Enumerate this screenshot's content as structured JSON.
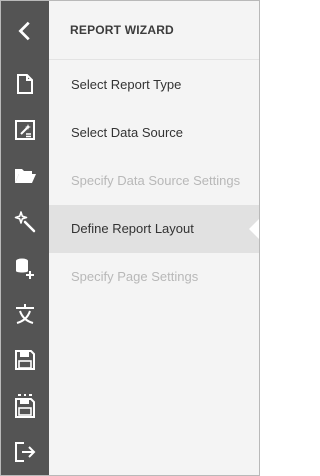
{
  "panel": {
    "title": "REPORT WIZARD"
  },
  "steps": [
    {
      "label": "Select Report Type",
      "state": "enabled"
    },
    {
      "label": "Select Data Source",
      "state": "enabled"
    },
    {
      "label": "Specify Data Source Settings",
      "state": "disabled"
    },
    {
      "label": "Define Report Layout",
      "state": "active"
    },
    {
      "label": "Specify Page Settings",
      "state": "disabled"
    }
  ],
  "toolbar": {
    "icons": [
      "back-chevron-icon",
      "new-report-icon",
      "new-report-wizard-icon",
      "open-folder-icon",
      "magic-wand-icon",
      "add-data-source-icon",
      "localization-icon",
      "save-icon",
      "save-as-icon",
      "exit-icon"
    ]
  },
  "colors": {
    "toolbar": "#545454",
    "panel": "#f4f4f4",
    "active_step": "#e1e1e1",
    "disabled_text": "#b8b8b8"
  }
}
